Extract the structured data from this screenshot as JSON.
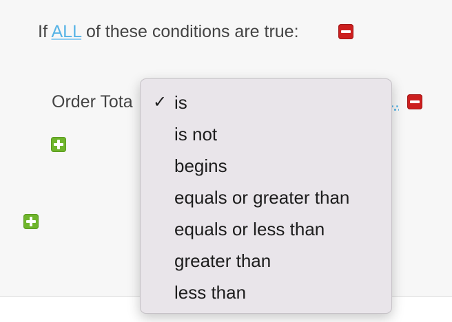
{
  "header": {
    "prefix": "If",
    "match_mode": "ALL",
    "suffix": "of these conditions are true:"
  },
  "rule": {
    "field_label": "Order Tota",
    "value_link": ".."
  },
  "dropdown": {
    "selected": "is",
    "check_glyph": "✓",
    "options": [
      "is",
      "is not",
      "begins",
      "equals or greater than",
      "equals or less than",
      "greater than",
      "less than"
    ]
  },
  "icons": {
    "remove": "remove-icon",
    "add": "add-icon"
  },
  "colors": {
    "link": "#58b4e6",
    "remove": "#cc1f1f",
    "add": "#6fb52c",
    "menu_bg": "#e9e5ea"
  }
}
